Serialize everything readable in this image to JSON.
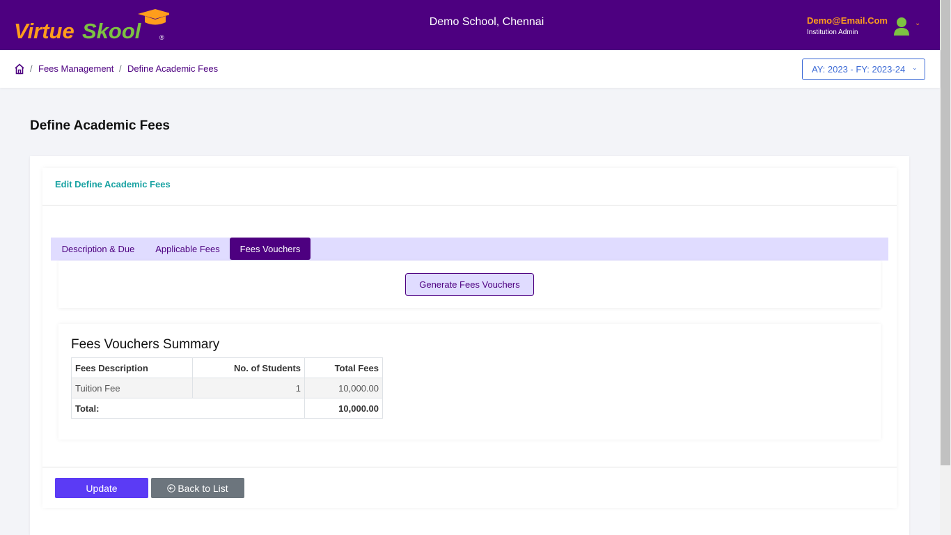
{
  "header": {
    "logo_text_virtue": "Virtue",
    "logo_text_skool": "Skool",
    "logo_reg": "®",
    "school_name": "Demo School, Chennai",
    "user_email": "Demo@Email.Com",
    "user_role": "Institution Admin",
    "colors": {
      "bar": "#4d0080",
      "email": "#ff9d1c",
      "avatar": "#7dc242"
    }
  },
  "breadcrumb": {
    "items": [
      "Fees Management",
      "Define Academic Fees"
    ],
    "separator": "/",
    "year_selector": "AY: 2023 - FY: 2023-24"
  },
  "page": {
    "title": "Define Academic Fees",
    "card_title": "Edit Define Academic Fees"
  },
  "tabs": [
    {
      "label": "Description & Due",
      "active": false
    },
    {
      "label": "Applicable Fees",
      "active": false
    },
    {
      "label": "Fees Vouchers",
      "active": true
    }
  ],
  "generate_button": "Generate Fees Vouchers",
  "summary": {
    "title": "Fees Vouchers Summary",
    "columns": [
      "Fees Description",
      "No. of Students",
      "Total Fees"
    ],
    "rows": [
      {
        "description": "Tuition Fee",
        "students": "1",
        "total": "10,000.00"
      }
    ],
    "total_label": "Total:",
    "total_value": "10,000.00"
  },
  "actions": {
    "update": "Update",
    "back": "Back to List"
  }
}
